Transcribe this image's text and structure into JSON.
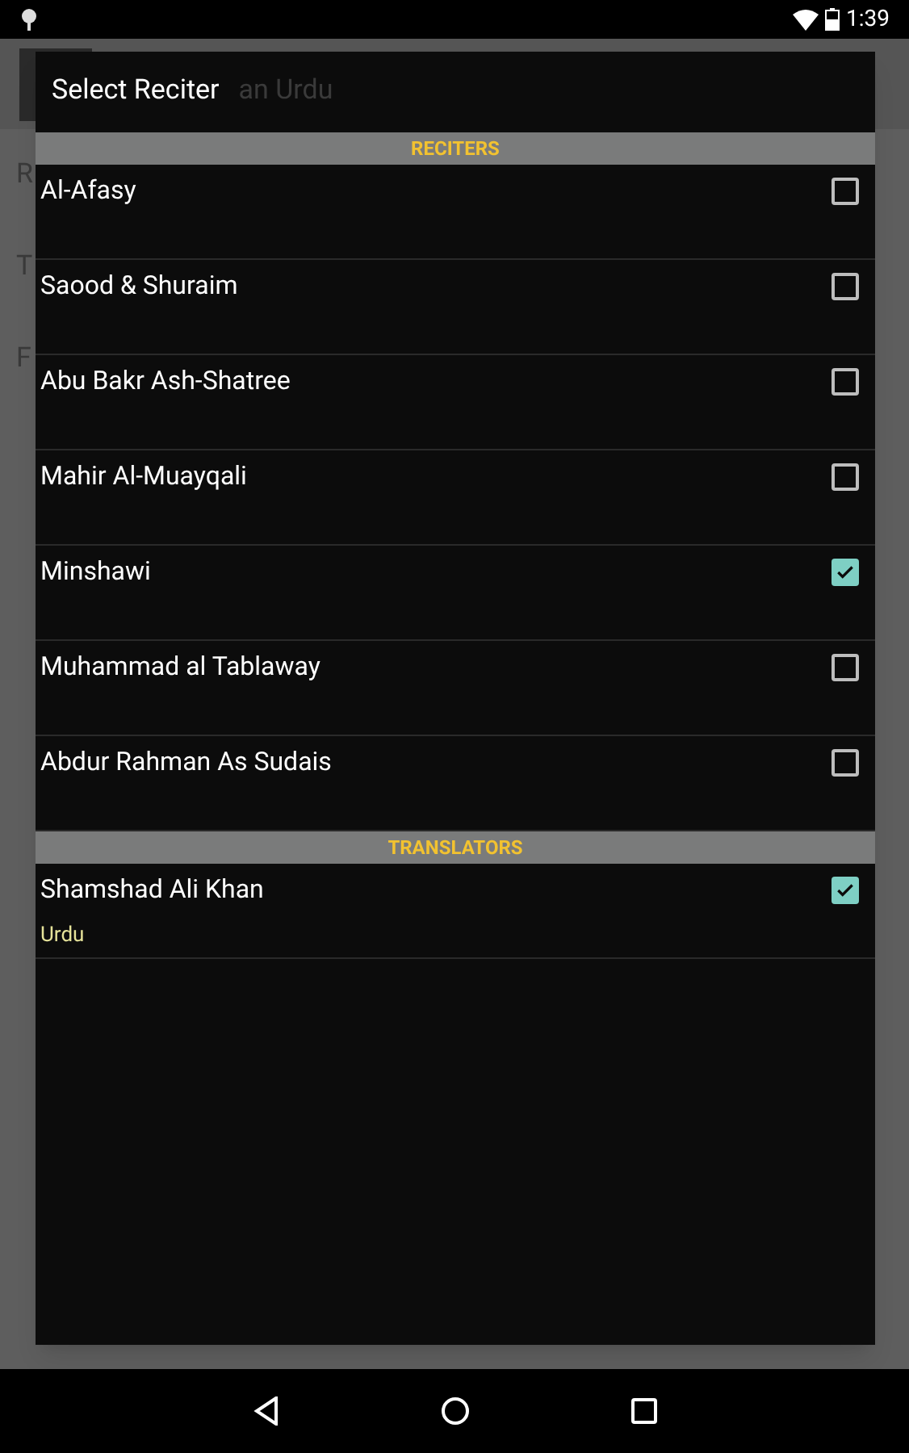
{
  "status_bar": {
    "time": "1:39"
  },
  "background": {
    "title": "an Urdu",
    "items": [
      "R",
      "T",
      "F"
    ]
  },
  "dialog": {
    "title": "Select Reciter",
    "sections": [
      {
        "header": "RECITERS",
        "items": [
          {
            "name": "Al-Afasy",
            "checked": false
          },
          {
            "name": "Saood & Shuraim",
            "checked": false
          },
          {
            "name": "Abu Bakr Ash-Shatree",
            "checked": false
          },
          {
            "name": "Mahir Al-Muayqali",
            "checked": false
          },
          {
            "name": "Minshawi",
            "checked": true
          },
          {
            "name": "Muhammad al Tablaway",
            "checked": false
          },
          {
            "name": "Abdur Rahman As Sudais",
            "checked": false
          }
        ]
      },
      {
        "header": "TRANSLATORS",
        "items": [
          {
            "name": "Shamshad Ali Khan",
            "subtitle": "Urdu",
            "checked": true
          }
        ]
      }
    ]
  }
}
